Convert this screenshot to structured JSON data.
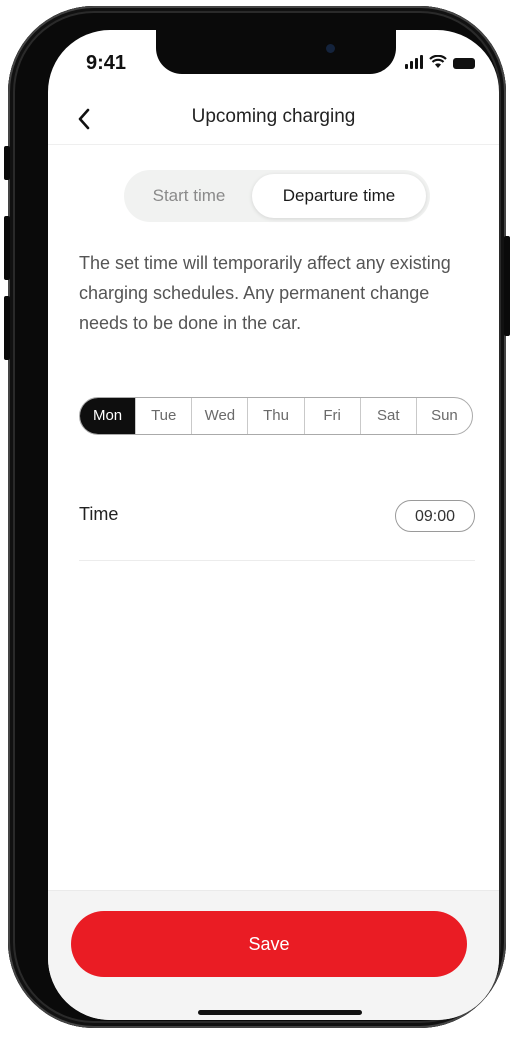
{
  "status_bar": {
    "time": "9:41"
  },
  "header": {
    "back_icon": "chevron-left-icon",
    "title": "Upcoming charging"
  },
  "mode_toggle": {
    "options": [
      "Start time",
      "Departure time"
    ],
    "selected": "Departure time"
  },
  "info_text": "The set time will temporarily affect any existing charging schedules. Any permanent change needs to be done in the car.",
  "days": {
    "items": [
      "Mon",
      "Tue",
      "Wed",
      "Thu",
      "Fri",
      "Sat",
      "Sun"
    ],
    "selected": "Mon"
  },
  "time_setting": {
    "label": "Time",
    "value": "09:00"
  },
  "footer": {
    "save_label": "Save"
  },
  "colors": {
    "accent": "#ea1c24",
    "selected_day": "#0e0e0e"
  }
}
